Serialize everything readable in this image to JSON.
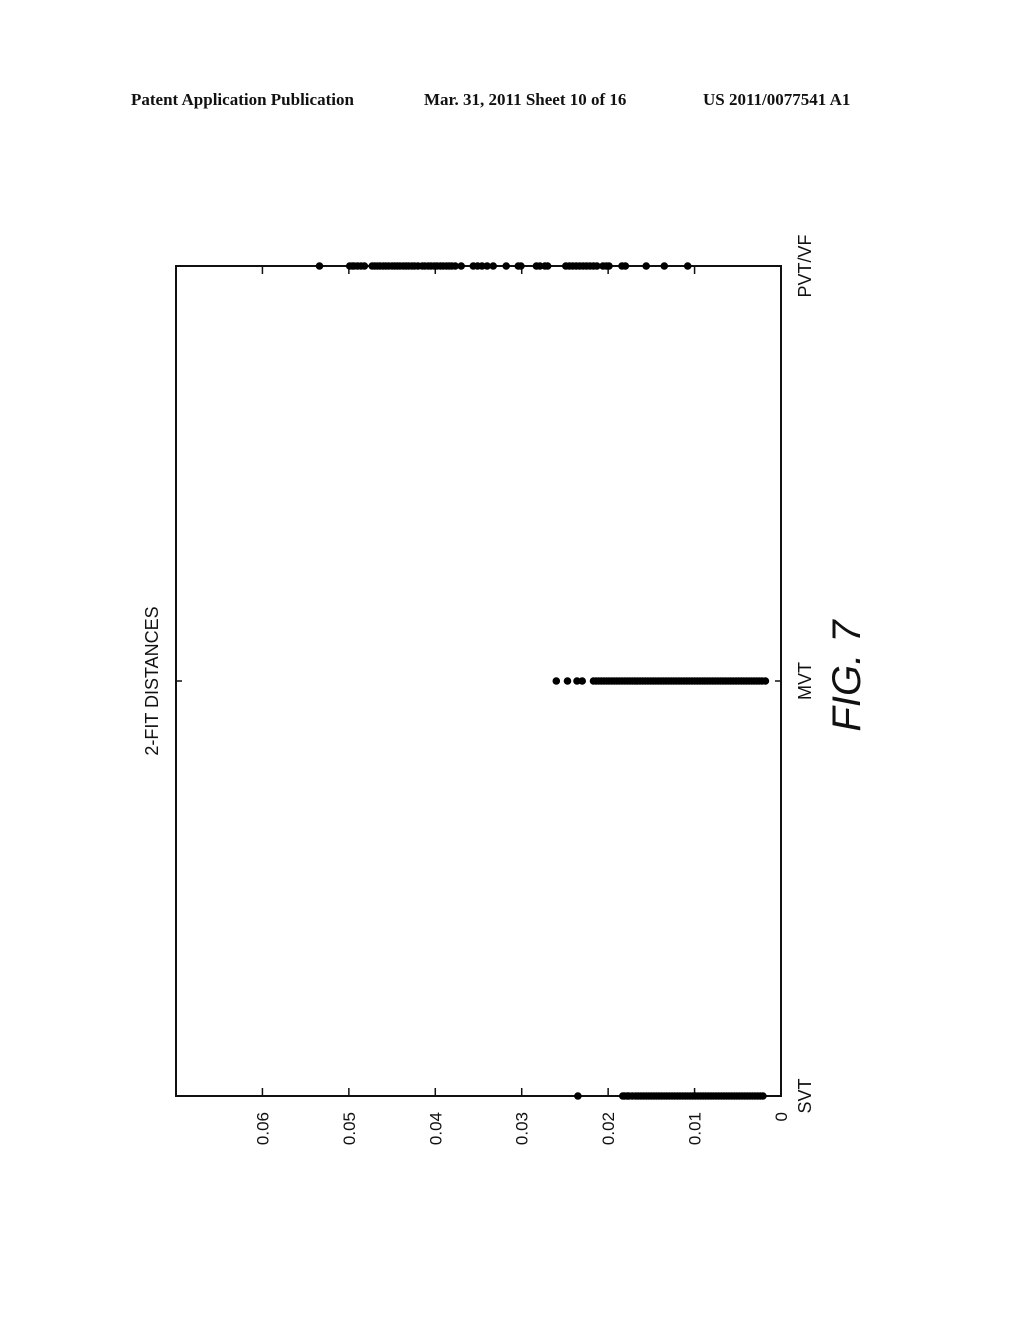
{
  "header": {
    "publication": "Patent Application Publication",
    "date_sheet": "Mar. 31, 2011  Sheet 10 of 16",
    "patent_number": "US 2011/0077541 A1"
  },
  "figure_label": "FIG. 7",
  "chart_data": {
    "type": "scatter",
    "orientation": "rotated 90° (categories along page vertical, values along page horizontal)",
    "title": "2-FIT DISTANCES",
    "xlabel": "",
    "ylabel": "",
    "categories": [
      "SVT",
      "MVT",
      "PVT/VF"
    ],
    "ylim": [
      0,
      0.07
    ],
    "yticks": [
      0,
      0.01,
      0.02,
      0.03,
      0.04,
      0.05,
      0.06
    ],
    "ytick_labels": [
      "0",
      "0.01",
      "0.02",
      "0.03",
      "0.04",
      "0.05",
      "0.06"
    ],
    "grid": false,
    "legend": "none",
    "series": [
      {
        "name": "SVT",
        "category": "SVT",
        "outliers": [
          0.0235
        ],
        "dense_range": [
          0.0021,
          0.0183
        ],
        "values": [
          0.0235,
          0.0183,
          0.0181,
          0.0178,
          0.0176,
          0.0172,
          0.0168,
          0.0165,
          0.0162,
          0.0159,
          0.0156,
          0.0153,
          0.015,
          0.0147,
          0.0144,
          0.0141,
          0.0138,
          0.0135,
          0.0132,
          0.0129,
          0.0126,
          0.0123,
          0.012,
          0.0117,
          0.0114,
          0.0111,
          0.0108,
          0.0105,
          0.0102,
          0.0099,
          0.0096,
          0.0093,
          0.009,
          0.0087,
          0.0084,
          0.0081,
          0.0078,
          0.0075,
          0.0072,
          0.0069,
          0.0066,
          0.0063,
          0.006,
          0.0057,
          0.0054,
          0.0051,
          0.0048,
          0.0045,
          0.0042,
          0.0039,
          0.0036,
          0.0033,
          0.003,
          0.0027,
          0.0024,
          0.0021
        ]
      },
      {
        "name": "MVT",
        "category": "MVT",
        "dense_range": [
          0.0018,
          0.0217
        ],
        "values": [
          0.026,
          0.0247,
          0.0236,
          0.023,
          0.0217,
          0.0214,
          0.0211,
          0.0208,
          0.0205,
          0.0202,
          0.0199,
          0.0196,
          0.0193,
          0.019,
          0.0187,
          0.0184,
          0.0181,
          0.0178,
          0.0175,
          0.0172,
          0.0169,
          0.0166,
          0.0163,
          0.016,
          0.0157,
          0.0154,
          0.0151,
          0.0148,
          0.0145,
          0.0142,
          0.0139,
          0.0136,
          0.0133,
          0.013,
          0.0127,
          0.0124,
          0.0121,
          0.0118,
          0.0115,
          0.0112,
          0.0109,
          0.0106,
          0.0103,
          0.01,
          0.0097,
          0.0094,
          0.0091,
          0.0088,
          0.0085,
          0.0082,
          0.0079,
          0.0076,
          0.0073,
          0.007,
          0.0067,
          0.0064,
          0.0061,
          0.0058,
          0.0055,
          0.0052,
          0.0049,
          0.0046,
          0.0043,
          0.004,
          0.0037,
          0.0034,
          0.0031,
          0.0028,
          0.0025,
          0.0022,
          0.0018
        ]
      },
      {
        "name": "PVT/VF",
        "category": "PVT/VF",
        "values": [
          0.0534,
          0.0499,
          0.0496,
          0.0494,
          0.049,
          0.0486,
          0.0482,
          0.0473,
          0.047,
          0.0467,
          0.0464,
          0.046,
          0.0457,
          0.0454,
          0.045,
          0.0447,
          0.0444,
          0.0441,
          0.0437,
          0.0434,
          0.0431,
          0.0427,
          0.0424,
          0.042,
          0.0415,
          0.0412,
          0.0408,
          0.0405,
          0.0401,
          0.0398,
          0.0394,
          0.0391,
          0.0387,
          0.0384,
          0.0381,
          0.0377,
          0.037,
          0.0356,
          0.0351,
          0.0346,
          0.034,
          0.0333,
          0.0318,
          0.0304,
          0.0301,
          0.0283,
          0.0279,
          0.0273,
          0.027,
          0.0249,
          0.0245,
          0.0241,
          0.0237,
          0.0233,
          0.0229,
          0.0225,
          0.0221,
          0.0217,
          0.0213,
          0.0206,
          0.0202,
          0.0199,
          0.0184,
          0.018,
          0.0156,
          0.0135,
          0.0108
        ]
      }
    ]
  }
}
